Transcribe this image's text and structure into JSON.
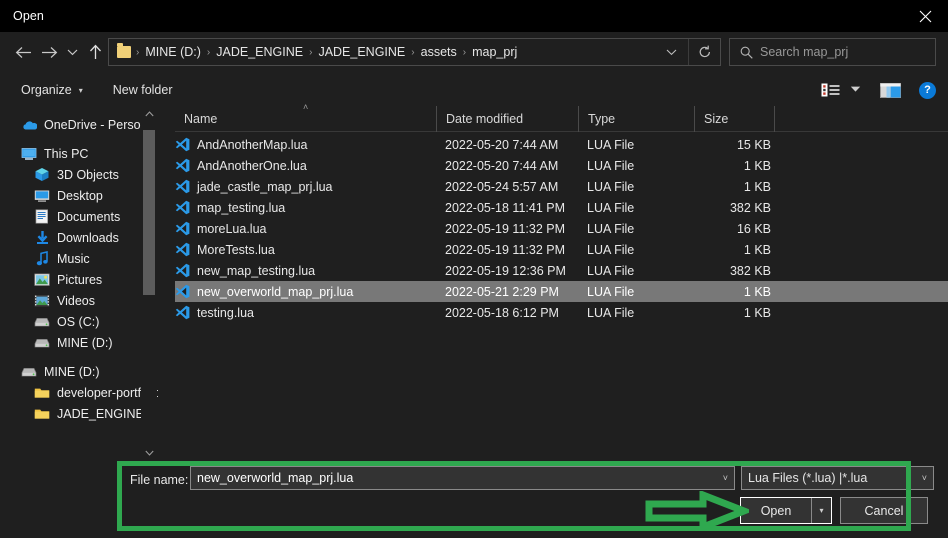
{
  "window": {
    "title": "Open",
    "close_icon": "close-icon"
  },
  "nav": {
    "back_icon": "arrow-left-icon",
    "forward_icon": "arrow-right-icon",
    "recent_icon": "chevron-down-icon",
    "up_icon": "arrow-up-icon",
    "folder_icon": "folder-icon",
    "breadcrumb": [
      "MINE (D:)",
      "JADE_ENGINE",
      "JADE_ENGINE",
      "assets",
      "map_prj"
    ],
    "breadcrumb_separator": "›",
    "breadcrumb_dropdown_icon": "chevron-down-icon",
    "refresh_icon": "refresh-icon"
  },
  "search": {
    "placeholder": "Search map_prj",
    "icon": "search-icon"
  },
  "toolbar": {
    "organize_label": "Organize",
    "organize_caret": "▾",
    "new_folder_label": "New folder",
    "view_options_icon": "view-options-icon",
    "view_caret": "▾",
    "preview_pane_icon": "preview-pane-icon",
    "help_label": "?"
  },
  "sidebar": {
    "scroll_up_icon": "chevron-up-icon",
    "scroll_down_icon": "chevron-down-icon",
    "items": [
      {
        "label": "OneDrive - Personal",
        "icon": "onedrive-icon",
        "indent": 0
      },
      {
        "label": "This PC",
        "icon": "this-pc-icon",
        "indent": 0
      },
      {
        "label": "3D Objects",
        "icon": "3d-objects-icon",
        "indent": 1
      },
      {
        "label": "Desktop",
        "icon": "desktop-icon",
        "indent": 1
      },
      {
        "label": "Documents",
        "icon": "documents-icon",
        "indent": 1
      },
      {
        "label": "Downloads",
        "icon": "downloads-icon",
        "indent": 1
      },
      {
        "label": "Music",
        "icon": "music-icon",
        "indent": 1
      },
      {
        "label": "Pictures",
        "icon": "pictures-icon",
        "indent": 1
      },
      {
        "label": "Videos",
        "icon": "videos-icon",
        "indent": 1
      },
      {
        "label": "OS (C:)",
        "icon": "drive-icon",
        "indent": 1
      },
      {
        "label": "MINE (D:)",
        "icon": "drive-icon",
        "indent": 1
      },
      {
        "label": "MINE (D:)",
        "icon": "drive-icon",
        "indent": 0
      },
      {
        "label": "developer-portfolio",
        "icon": "folder-icon",
        "indent": 1
      },
      {
        "label": "JADE_ENGINE",
        "icon": "folder-icon",
        "indent": 1
      }
    ]
  },
  "filelist": {
    "columns": [
      "Name",
      "Date modified",
      "Type",
      "Size"
    ],
    "sort_indicator": "˄",
    "rows": [
      {
        "name": "AndAnotherMap.lua",
        "date": "2022-05-20 7:44 AM",
        "type": "LUA File",
        "size": "15 KB",
        "icon": "vscode-file-icon",
        "selected": false
      },
      {
        "name": "AndAnotherOne.lua",
        "date": "2022-05-20 7:44 AM",
        "type": "LUA File",
        "size": "1 KB",
        "icon": "vscode-file-icon",
        "selected": false
      },
      {
        "name": "jade_castle_map_prj.lua",
        "date": "2022-05-24 5:57 AM",
        "type": "LUA File",
        "size": "1 KB",
        "icon": "vscode-file-icon",
        "selected": false
      },
      {
        "name": "map_testing.lua",
        "date": "2022-05-18 11:41 PM",
        "type": "LUA File",
        "size": "382 KB",
        "icon": "vscode-file-icon",
        "selected": false
      },
      {
        "name": "moreLua.lua",
        "date": "2022-05-19 11:32 PM",
        "type": "LUA File",
        "size": "16 KB",
        "icon": "vscode-file-icon",
        "selected": false
      },
      {
        "name": "MoreTests.lua",
        "date": "2022-05-19 11:32 PM",
        "type": "LUA File",
        "size": "1 KB",
        "icon": "vscode-file-icon",
        "selected": false
      },
      {
        "name": "new_map_testing.lua",
        "date": "2022-05-19 12:36 PM",
        "type": "LUA File",
        "size": "382 KB",
        "icon": "vscode-file-icon",
        "selected": false
      },
      {
        "name": "new_overworld_map_prj.lua",
        "date": "2022-05-21 2:29 PM",
        "type": "LUA File",
        "size": "1 KB",
        "icon": "vscode-file-icon",
        "selected": true
      },
      {
        "name": "testing.lua",
        "date": "2022-05-18 6:12 PM",
        "type": "LUA File",
        "size": "1 KB",
        "icon": "vscode-file-icon",
        "selected": false
      }
    ]
  },
  "footer": {
    "file_name_label": "File name:",
    "file_name_value": "new_overworld_map_prj.lua",
    "file_name_caret": "˅",
    "file_type_value": "Lua Files (*.lua) |*.lua",
    "file_type_caret": "˅",
    "open_label": "Open",
    "open_split_caret": "▾",
    "cancel_label": "Cancel"
  },
  "annotation": {
    "highlight_color": "#2fa84f",
    "arrow_icon": "green-arrow-right-icon",
    "box_icon": "green-highlight-box"
  }
}
